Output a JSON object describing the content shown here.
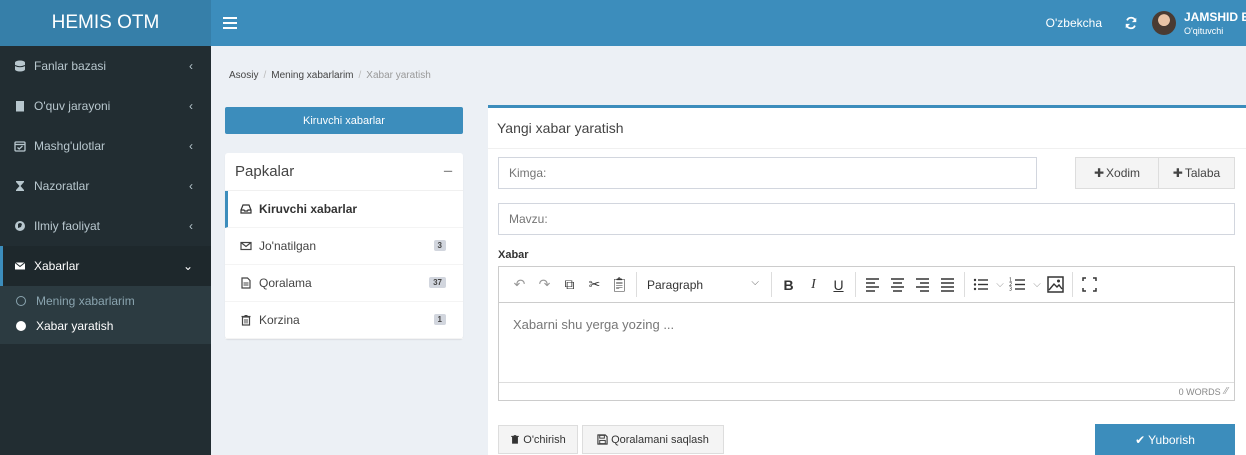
{
  "header": {
    "logo": "HEMIS OTM",
    "language": "O'zbekcha",
    "user_name": "JAMSHID ELOV",
    "user_role": "O'qituvchi"
  },
  "sidebar": {
    "items": [
      {
        "label": "Fanlar bazasi",
        "icon": "database-icon"
      },
      {
        "label": "O'quv jarayoni",
        "icon": "book-icon"
      },
      {
        "label": "Mashg'ulotlar",
        "icon": "calendar-check-icon"
      },
      {
        "label": "Nazoratlar",
        "icon": "hourglass-icon"
      },
      {
        "label": "Ilmiy faoliyat",
        "icon": "globe-icon"
      },
      {
        "label": "Xabarlar",
        "icon": "envelope-icon"
      }
    ],
    "submenu": [
      {
        "label": "Mening xabarlarim"
      },
      {
        "label": "Xabar yaratish"
      }
    ]
  },
  "breadcrumb": {
    "home": "Asosiy",
    "level1": "Mening xabarlarim",
    "current": "Xabar yaratish"
  },
  "left": {
    "inbox_button": "Kiruvchi xabarlar",
    "folders_title": "Papkalar",
    "folders": [
      {
        "label": "Kiruvchi xabarlar",
        "icon": "inbox-icon",
        "badge": ""
      },
      {
        "label": "Jo'natilgan",
        "icon": "envelope-outline-icon",
        "badge": "3"
      },
      {
        "label": "Qoralama",
        "icon": "file-icon",
        "badge": "37"
      },
      {
        "label": "Korzina",
        "icon": "trash-icon",
        "badge": "1"
      }
    ]
  },
  "compose": {
    "title": "Yangi xabar yaratish",
    "to_placeholder": "Kimga:",
    "subject_placeholder": "Mavzu:",
    "employee_button": "Xodim",
    "student_button": "Talaba",
    "message_label": "Xabar",
    "paragraph_select": "Paragraph",
    "editor_placeholder": "Xabarni shu yerga yozing ...",
    "word_count": "0 WORDS",
    "delete_button": "O'chirish",
    "save_draft_button": "Qoralamani saqlash",
    "send_button": "Yuborish"
  },
  "colors": {
    "primary": "#3c8dbc",
    "logo_bg": "#367fa9",
    "sidebar_bg": "#222d32"
  }
}
